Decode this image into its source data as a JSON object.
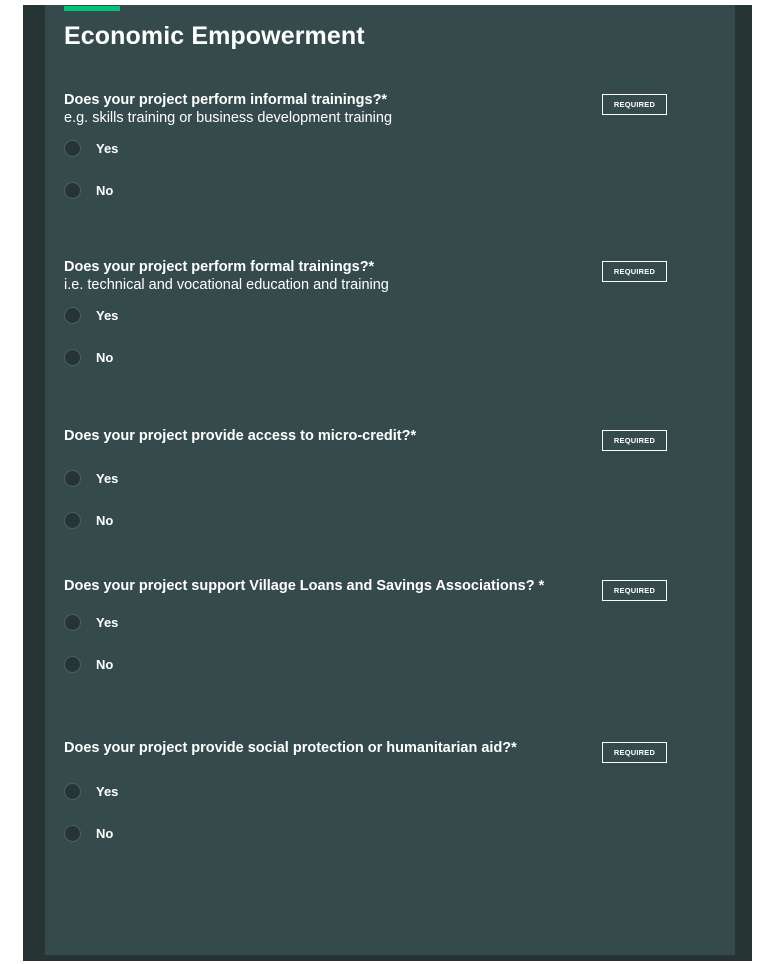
{
  "colors": {
    "accent": "#00c27a",
    "panel": "#354a4b",
    "frame": "#263433",
    "text": "#ffffff"
  },
  "section": {
    "title": "Economic Empowerment"
  },
  "required_label": "REQUIRED",
  "questions": [
    {
      "title": "Does your project perform informal trainings?*",
      "hint": "e.g. skills training or business development training",
      "options": [
        "Yes",
        "No"
      ]
    },
    {
      "title": "Does your project perform formal trainings?*",
      "hint": "i.e. technical and vocational education and training",
      "options": [
        "Yes",
        "No"
      ]
    },
    {
      "title": "Does your project provide access to micro-credit?*",
      "hint": "",
      "options": [
        "Yes",
        "No"
      ]
    },
    {
      "title": "Does your project support Village Loans and Savings Associations? *",
      "hint": "",
      "options": [
        "Yes",
        "No"
      ]
    },
    {
      "title": "Does your project provide social protection or humanitarian aid?*",
      "hint": "",
      "options": [
        "Yes",
        "No"
      ]
    }
  ]
}
